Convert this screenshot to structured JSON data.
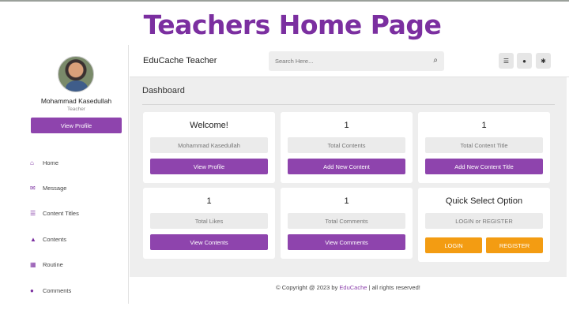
{
  "slide_title": "Teachers Home Page",
  "sidebar": {
    "user_name": "Mohammad Kasedullah",
    "user_role": "Teacher",
    "view_profile": "View Profile",
    "items": [
      {
        "label": "Home",
        "icon": "home-icon"
      },
      {
        "label": "Message",
        "icon": "message-icon"
      },
      {
        "label": "Content Titles",
        "icon": "list-icon"
      },
      {
        "label": "Contents",
        "icon": "graduation-cap-icon"
      },
      {
        "label": "Routine",
        "icon": "table-icon"
      },
      {
        "label": "Comments",
        "icon": "comment-icon"
      }
    ]
  },
  "header": {
    "brand": "EduCache Teacher",
    "search_placeholder": "Search Here...",
    "icons": [
      "menu-icon",
      "user-icon",
      "settings-icon"
    ]
  },
  "main": {
    "title": "Dashboard",
    "cards": [
      {
        "title": "Welcome!",
        "field": "Mohammad Kasedullah",
        "button": "View Profile"
      },
      {
        "title": "1",
        "field": "Total Contents",
        "button": "Add New Content"
      },
      {
        "title": "1",
        "field": "Total Content Title",
        "button": "Add New Content Title"
      },
      {
        "title": "1",
        "field": "Total Likes",
        "button": "View Contents"
      },
      {
        "title": "1",
        "field": "Total Comments",
        "button": "View Comments"
      },
      {
        "title": "Quick Select Option",
        "field": "LOGIN or REGISTER",
        "login": "LOGIN",
        "register": "REGISTER"
      }
    ]
  },
  "footer": {
    "prefix": "© Copyright @ 2023 by ",
    "brand": "EduCache",
    "suffix": " | all rights reserved!"
  },
  "colors": {
    "accent": "#8e44ad",
    "title": "#7b2fa0",
    "orange": "#f39c12"
  }
}
